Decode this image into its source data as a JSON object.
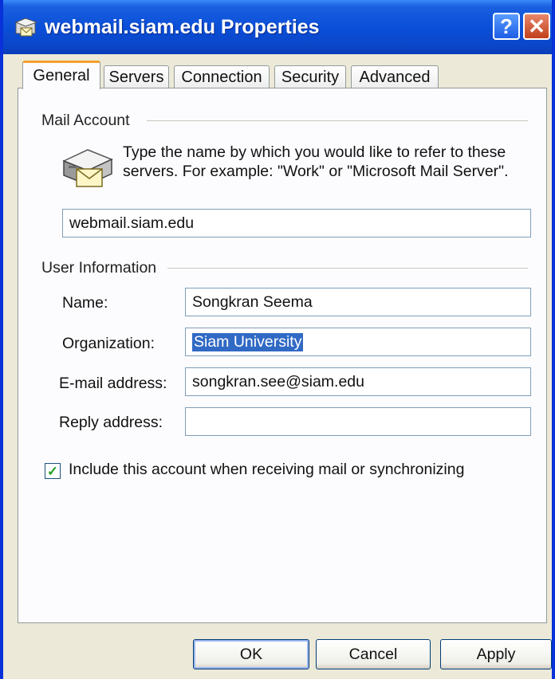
{
  "window": {
    "title": "webmail.siam.edu Properties",
    "help_label": "?",
    "close_label": "✕"
  },
  "tabs": [
    {
      "label": "General",
      "active": true
    },
    {
      "label": "Servers",
      "active": false
    },
    {
      "label": "Connection",
      "active": false
    },
    {
      "label": "Security",
      "active": false
    },
    {
      "label": "Advanced",
      "active": false
    }
  ],
  "mail_account": {
    "group_title": "Mail Account",
    "description": "Type the name by which you would like to refer to these servers.  For example: \"Work\" or \"Microsoft Mail Server\".",
    "account_name": "webmail.siam.edu"
  },
  "user_information": {
    "group_title": "User Information",
    "name_label": "Name:",
    "name_value": "Songkran Seema",
    "organization_label": "Organization:",
    "organization_value": "Siam University",
    "email_label": "E-mail address:",
    "email_value": "songkran.see@siam.edu",
    "reply_label": "Reply address:",
    "reply_value": ""
  },
  "include_account": {
    "checked": true,
    "label": "Include this account when receiving mail or synchronizing"
  },
  "buttons": {
    "ok": "OK",
    "cancel": "Cancel",
    "apply": "Apply"
  },
  "colors": {
    "titlebar": "#0a4fd8",
    "active_tab_accent": "#f4a12b",
    "selection": "#316ac5",
    "check": "#21a121"
  }
}
